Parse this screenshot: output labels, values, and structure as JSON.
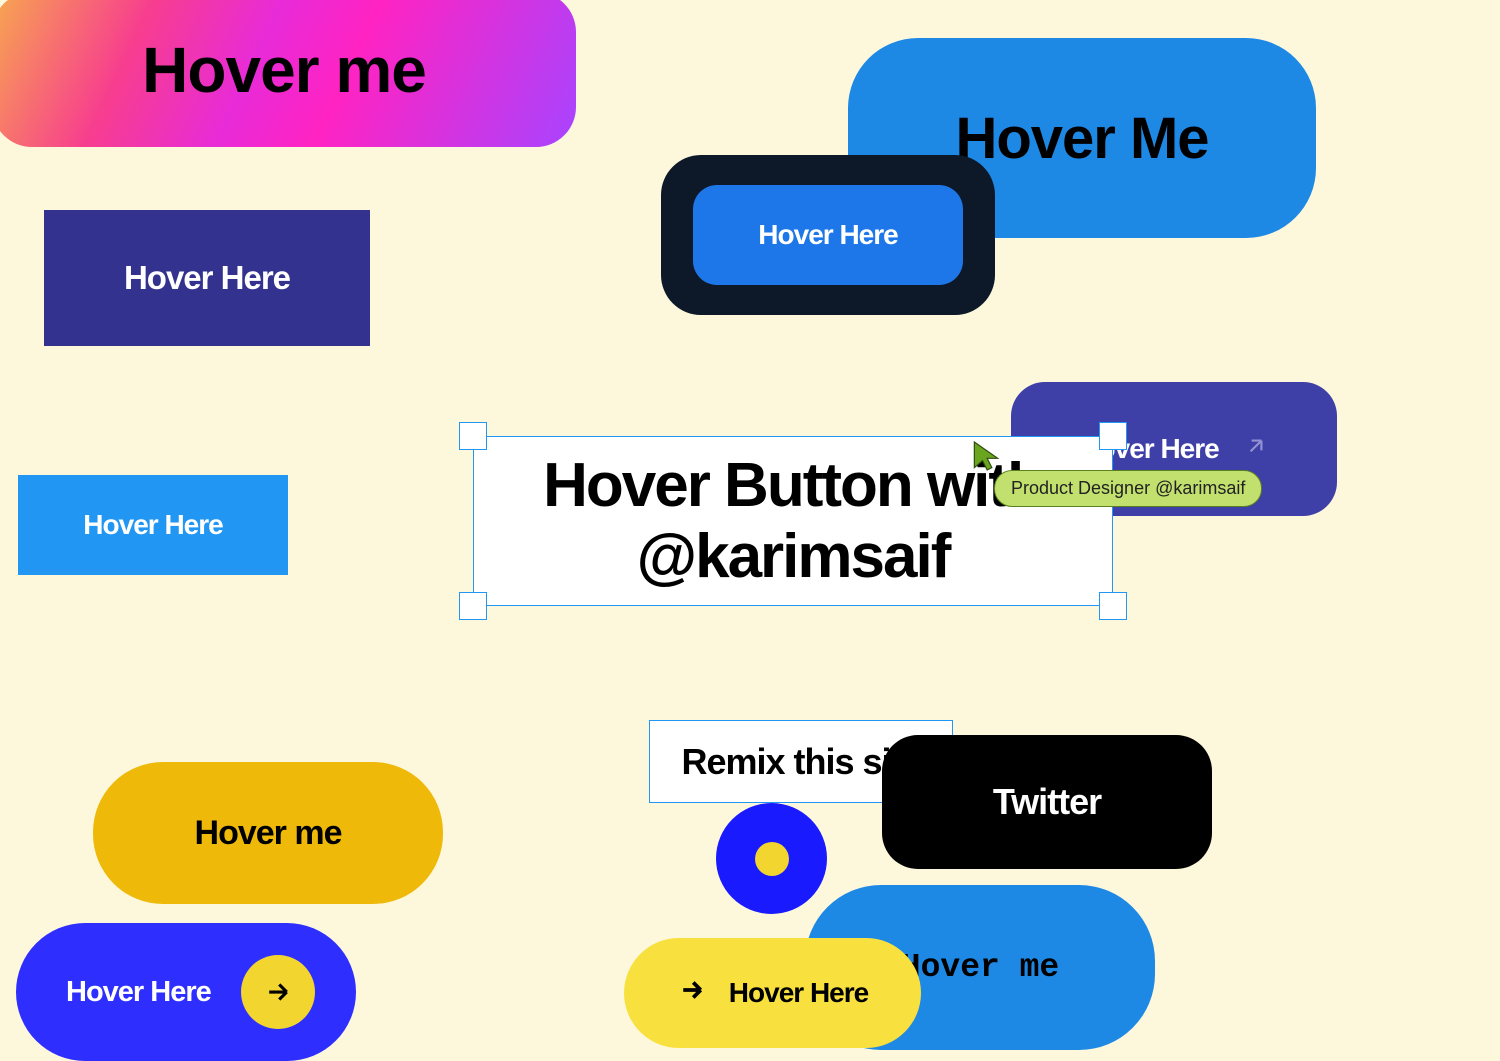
{
  "title": "Hover Button with @karimsaif",
  "tooltip": "Product Designer @karimsaif",
  "remix": "Remix this site",
  "buttons": {
    "gradient": "Hover me",
    "indigo": "Hover Here",
    "lightblue": "Hover Here",
    "bluepill_large": "Hover Me",
    "framed": "Hover Here",
    "purple_arrow": "Hover Here",
    "twitter": "Twitter",
    "yellow": "Hover me",
    "blue_arrow_circle": "Hover Here",
    "bluepill_medium": "Hover me",
    "yellow_arrow_left": "Hover Here"
  }
}
